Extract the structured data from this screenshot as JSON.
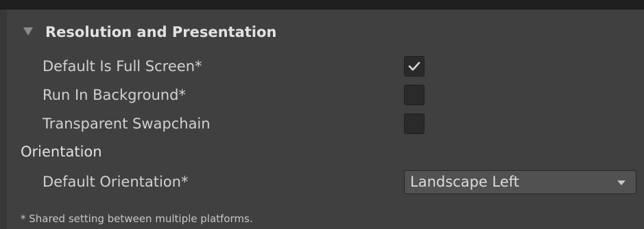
{
  "header": {
    "title": "Resolution and Presentation",
    "icon": "triangle-down-icon"
  },
  "settings": {
    "default_is_full_screen": {
      "label": "Default Is Full Screen*",
      "checked": true,
      "icon": "checkmark-icon"
    },
    "run_in_background": {
      "label": "Run In Background*",
      "checked": false
    },
    "transparent_swapchain": {
      "label": "Transparent Swapchain",
      "checked": false
    }
  },
  "orientation": {
    "section_label": "Orientation",
    "default_orientation_label": "Default Orientation*",
    "default_orientation_value": "Landscape Left",
    "dropdown_icon": "triangle-down-icon"
  },
  "footnote": "* Shared setting between multiple platforms.",
  "colors": {
    "panel_bg": "#404040",
    "text": "#d2d2d2",
    "checkbox_bg": "#2a2a2a",
    "dropdown_bg": "#515151"
  }
}
